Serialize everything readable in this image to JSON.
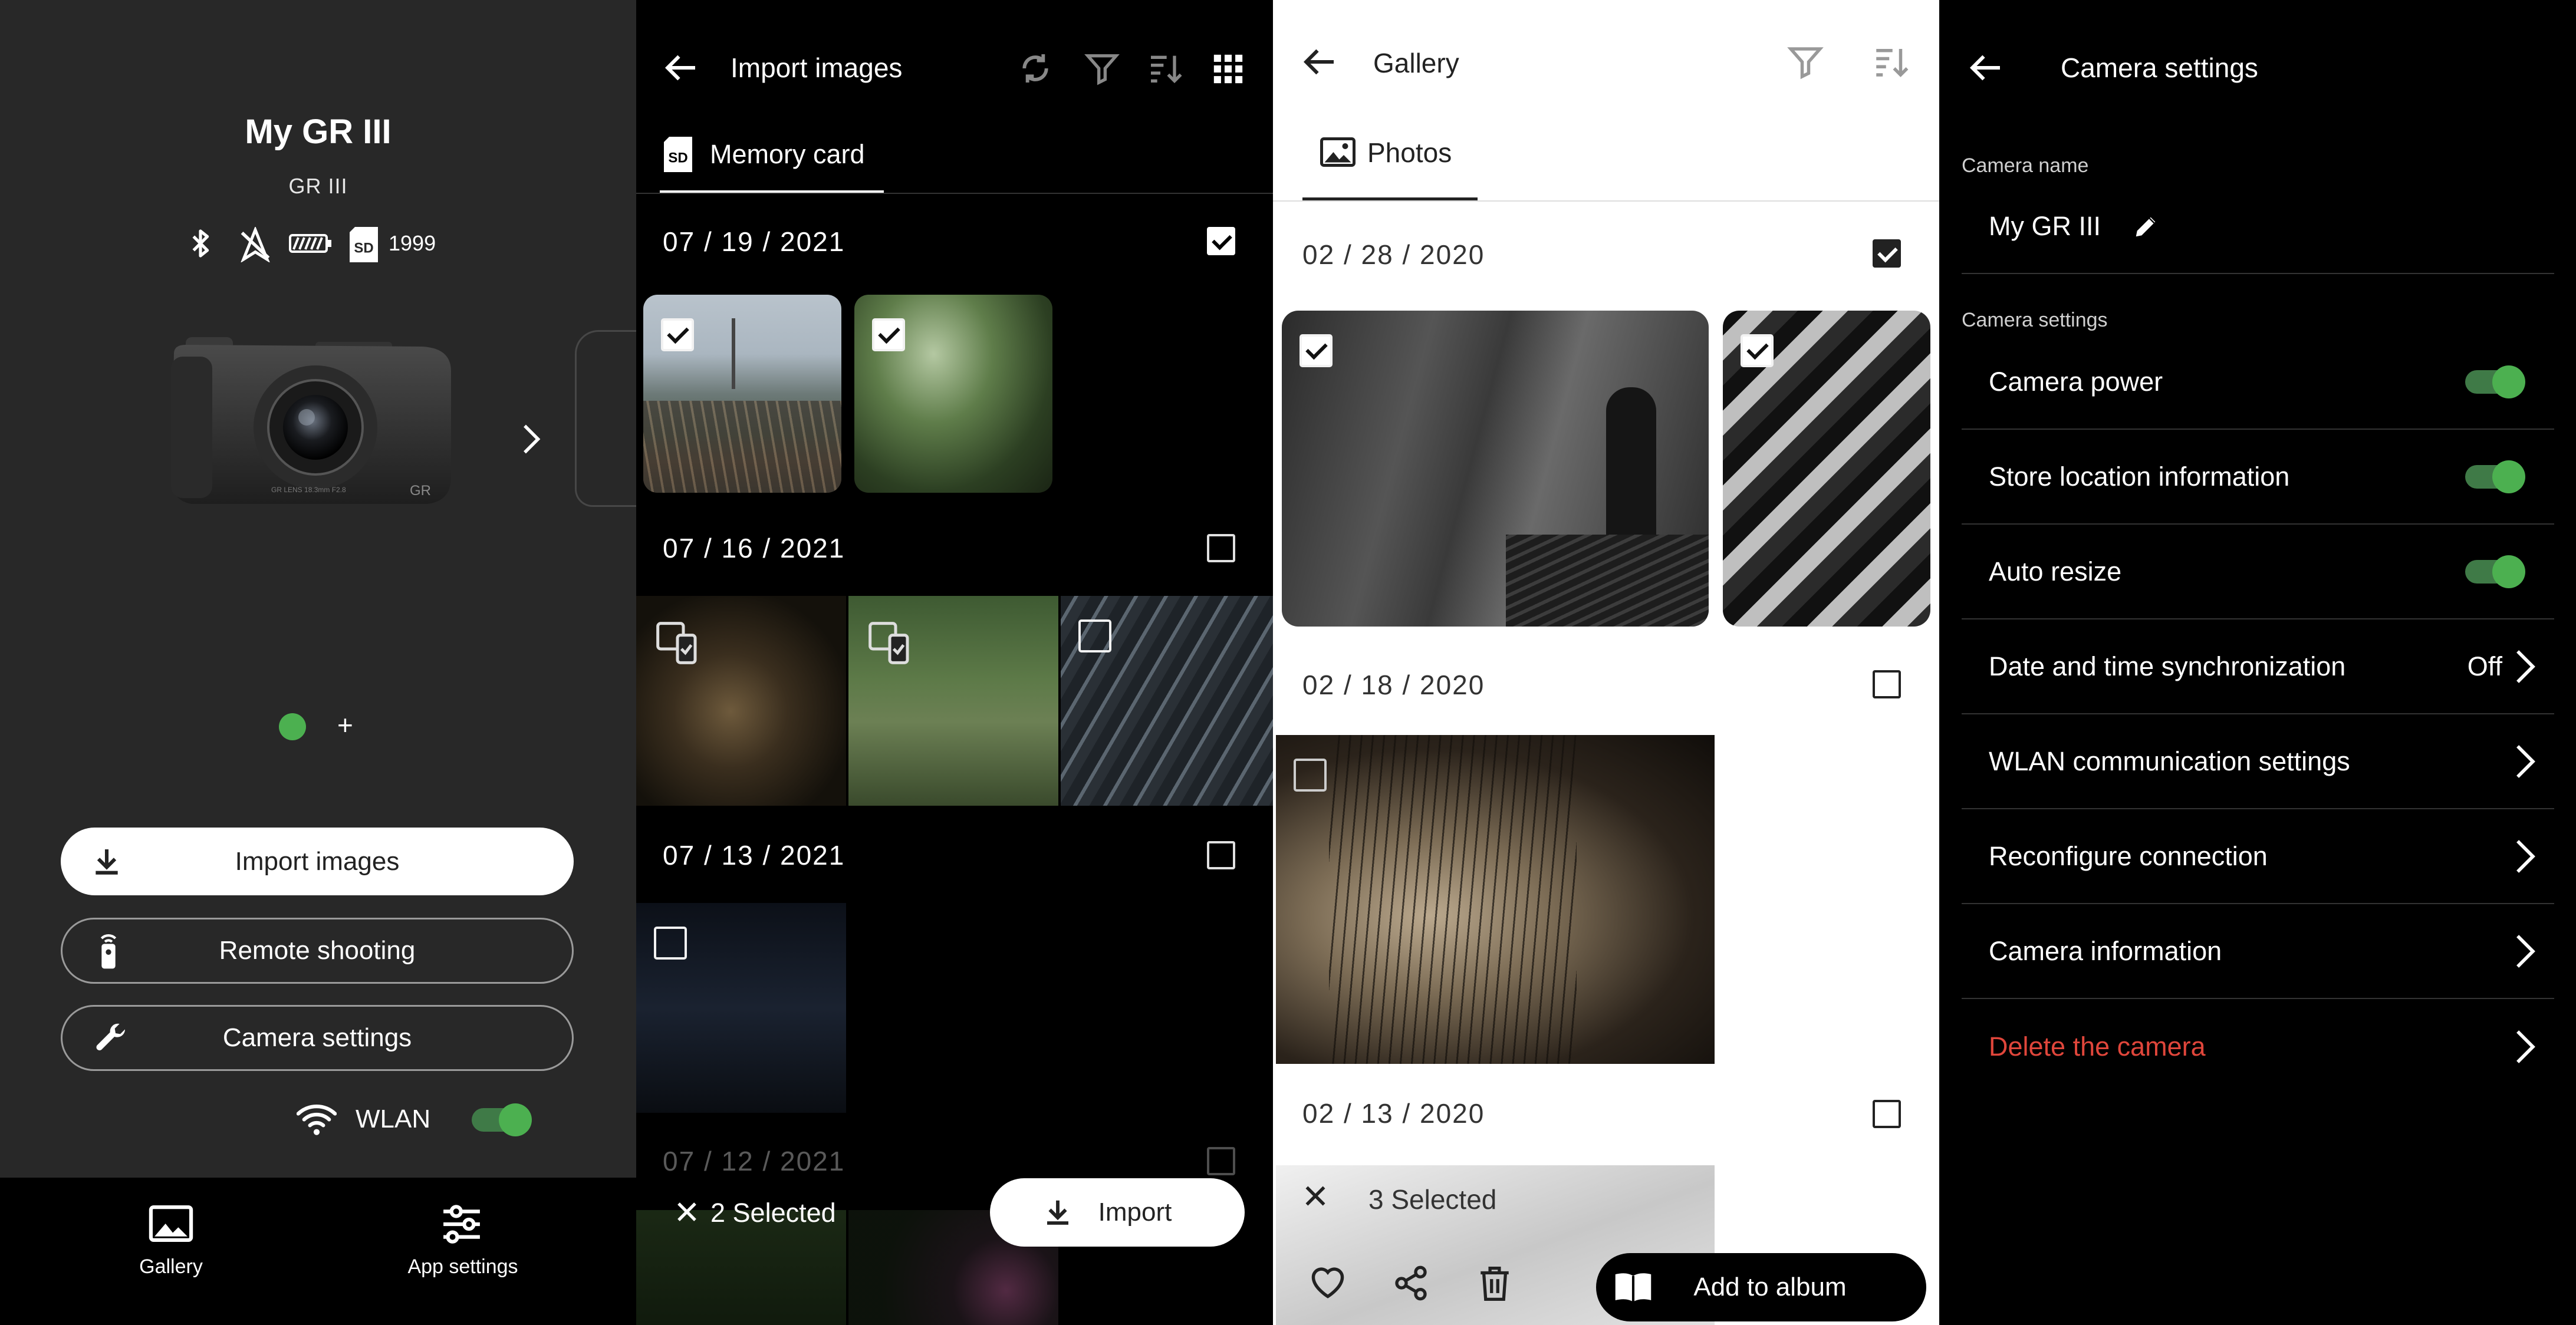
{
  "home": {
    "camera_name": "My GR III",
    "camera_model": "GR III",
    "card_count": "1999",
    "import_label": "Import images",
    "remote_label": "Remote shooting",
    "settings_label": "Camera settings",
    "wlan_label": "WLAN",
    "wlan_on": true,
    "add_symbol": "+",
    "nav": [
      {
        "label": "Gallery",
        "icon": "image-icon"
      },
      {
        "label": "App settings",
        "icon": "sliders-icon"
      }
    ]
  },
  "import": {
    "title": "Import images",
    "tab_label": "Memory card",
    "groups": [
      {
        "date": "07 / 19 / 2021",
        "checked": true
      },
      {
        "date": "07 / 16 / 2021",
        "checked": false
      },
      {
        "date": "07 / 13 / 2021",
        "checked": false
      },
      {
        "date": "07 / 12 / 2021",
        "checked": false
      }
    ],
    "selected_label": "2 Selected",
    "import_button": "Import"
  },
  "gallery": {
    "title": "Gallery",
    "tab_label": "Photos",
    "groups": [
      {
        "date": "02 / 28 / 2020",
        "checked": true
      },
      {
        "date": "02 / 18 / 2020",
        "checked": false
      },
      {
        "date": "02 / 13 / 2020",
        "checked": false
      }
    ],
    "selected_label": "3 Selected",
    "add_album_label": "Add to album"
  },
  "settings": {
    "title": "Camera settings",
    "name_section": "Camera name",
    "name_value": "My GR III",
    "settings_section": "Camera settings",
    "rows": [
      {
        "label": "Camera power",
        "toggle": true
      },
      {
        "label": "Store location information",
        "toggle": true
      },
      {
        "label": "Auto resize",
        "toggle": true
      },
      {
        "label": "Date and time synchronization",
        "value": "Off"
      },
      {
        "label": "WLAN communication settings"
      },
      {
        "label": "Reconfigure connection"
      },
      {
        "label": "Camera information"
      },
      {
        "label": "Delete the camera",
        "danger": true
      }
    ]
  },
  "colors": {
    "accent_green": "#4cb050",
    "danger_red": "#e0463b",
    "home_bg": "#282828"
  }
}
